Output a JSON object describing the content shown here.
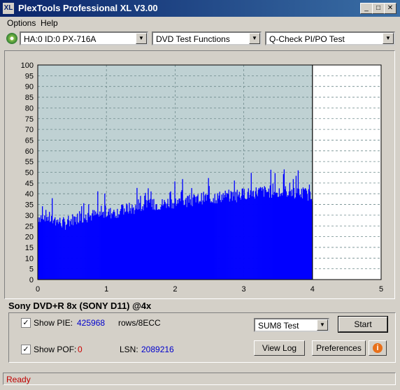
{
  "window": {
    "title": "PlexTools Professional XL V3.00",
    "app_icon": "XL"
  },
  "menu": {
    "options": "Options",
    "help": "Help"
  },
  "toolbar": {
    "drive": "HA:0 ID:0  PX-716A",
    "function": "DVD Test Functions",
    "test": "Q-Check PI/PO Test"
  },
  "colors": {
    "bar": "#0000ff",
    "plot_bg": "#bfd1d3",
    "empty_bg": "#ffffff",
    "status_text": "#c00000"
  },
  "chart_data": {
    "type": "bar",
    "xlim": [
      0,
      5
    ],
    "ylim": [
      0,
      100
    ],
    "xticks": [
      "0",
      "1",
      "2",
      "3",
      "4",
      "5"
    ],
    "yticks": [
      "0",
      "5",
      "10",
      "15",
      "20",
      "25",
      "30",
      "35",
      "40",
      "45",
      "50",
      "55",
      "60",
      "65",
      "70",
      "75",
      "80",
      "85",
      "90",
      "95",
      "100"
    ],
    "x": [
      0.0,
      0.1,
      0.2,
      0.3,
      0.4,
      0.5,
      0.6,
      0.7,
      0.8,
      0.9,
      1.0,
      1.1,
      1.2,
      1.3,
      1.4,
      1.5,
      1.6,
      1.7,
      1.8,
      1.9,
      2.0,
      2.1,
      2.2,
      2.3,
      2.4,
      2.5,
      2.6,
      2.7,
      2.8,
      2.9,
      3.0,
      3.1,
      3.2,
      3.3,
      3.4,
      3.5,
      3.6,
      3.7,
      3.8,
      3.9,
      4.0
    ],
    "values": [
      29,
      30,
      28,
      27,
      26,
      28,
      29,
      29,
      30,
      30,
      31,
      31,
      32,
      33,
      33,
      34,
      34,
      35,
      35,
      36,
      36,
      36,
      37,
      37,
      38,
      38,
      38,
      39,
      39,
      39,
      40,
      40,
      41,
      41,
      41,
      40,
      41,
      41,
      40,
      40,
      39
    ],
    "peaks": [
      40,
      38,
      39,
      36,
      33,
      37,
      37,
      38,
      40,
      42,
      40,
      41,
      42,
      44,
      43,
      45,
      44,
      46,
      46,
      48,
      46,
      47,
      48,
      49,
      49,
      50,
      49,
      51,
      50,
      48,
      52,
      53,
      57,
      52,
      54,
      51,
      53,
      50,
      52,
      51,
      45
    ],
    "end_x": 4
  },
  "disc": {
    "label": "Sony DVD+R 8x (SONY D11) @4x"
  },
  "stats": {
    "show_pie": "Show PIE:",
    "pie_value": "425968",
    "pie_unit": "rows/8ECC",
    "show_pof": "Show POF:",
    "pof_value": "0",
    "lsn_label": "LSN:",
    "lsn_value": "2089216",
    "pie_checked": true,
    "pof_checked": true
  },
  "controls": {
    "mode": "SUM8 Test",
    "start": "Start",
    "view_log": "View Log",
    "preferences": "Preferences"
  },
  "status": {
    "text": "Ready"
  }
}
